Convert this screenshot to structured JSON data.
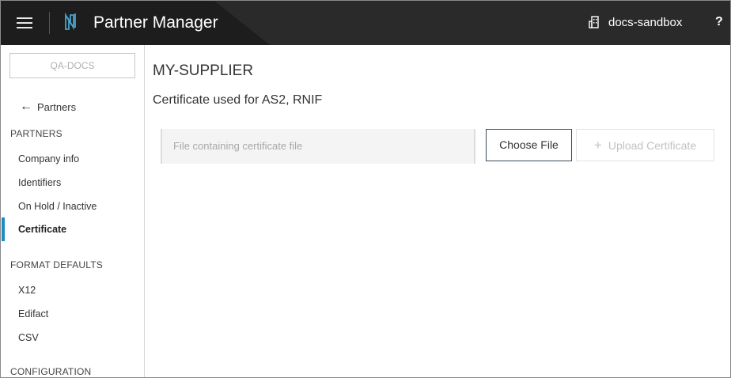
{
  "header": {
    "app_title": "Partner Manager",
    "tenant": "docs-sandbox",
    "help_label": "?"
  },
  "sidebar": {
    "tenant_box": "QA-DOCS",
    "back_link": "Partners",
    "sections": [
      {
        "title": "PARTNERS",
        "items": [
          "Company info",
          "Identifiers",
          "On Hold / Inactive",
          "Certificate"
        ]
      },
      {
        "title": "FORMAT DEFAULTS",
        "items": [
          "X12",
          "Edifact",
          "CSV"
        ]
      },
      {
        "title": "CONFIGURATION"
      }
    ],
    "active_item": "Certificate"
  },
  "main": {
    "title": "MY-SUPPLIER",
    "subtitle": "Certificate used for AS2, RNIF",
    "file_input_placeholder": "File containing certificate file",
    "choose_file_label": "Choose File",
    "upload_label": "Upload Certificate"
  },
  "colors": {
    "header_bg": "#1d1d1d",
    "accent": "#1e8bc3"
  },
  "icons": [
    "hamburger-menu-icon",
    "app-logo-icon",
    "building-icon",
    "arrow-left-icon",
    "plus-icon"
  ]
}
